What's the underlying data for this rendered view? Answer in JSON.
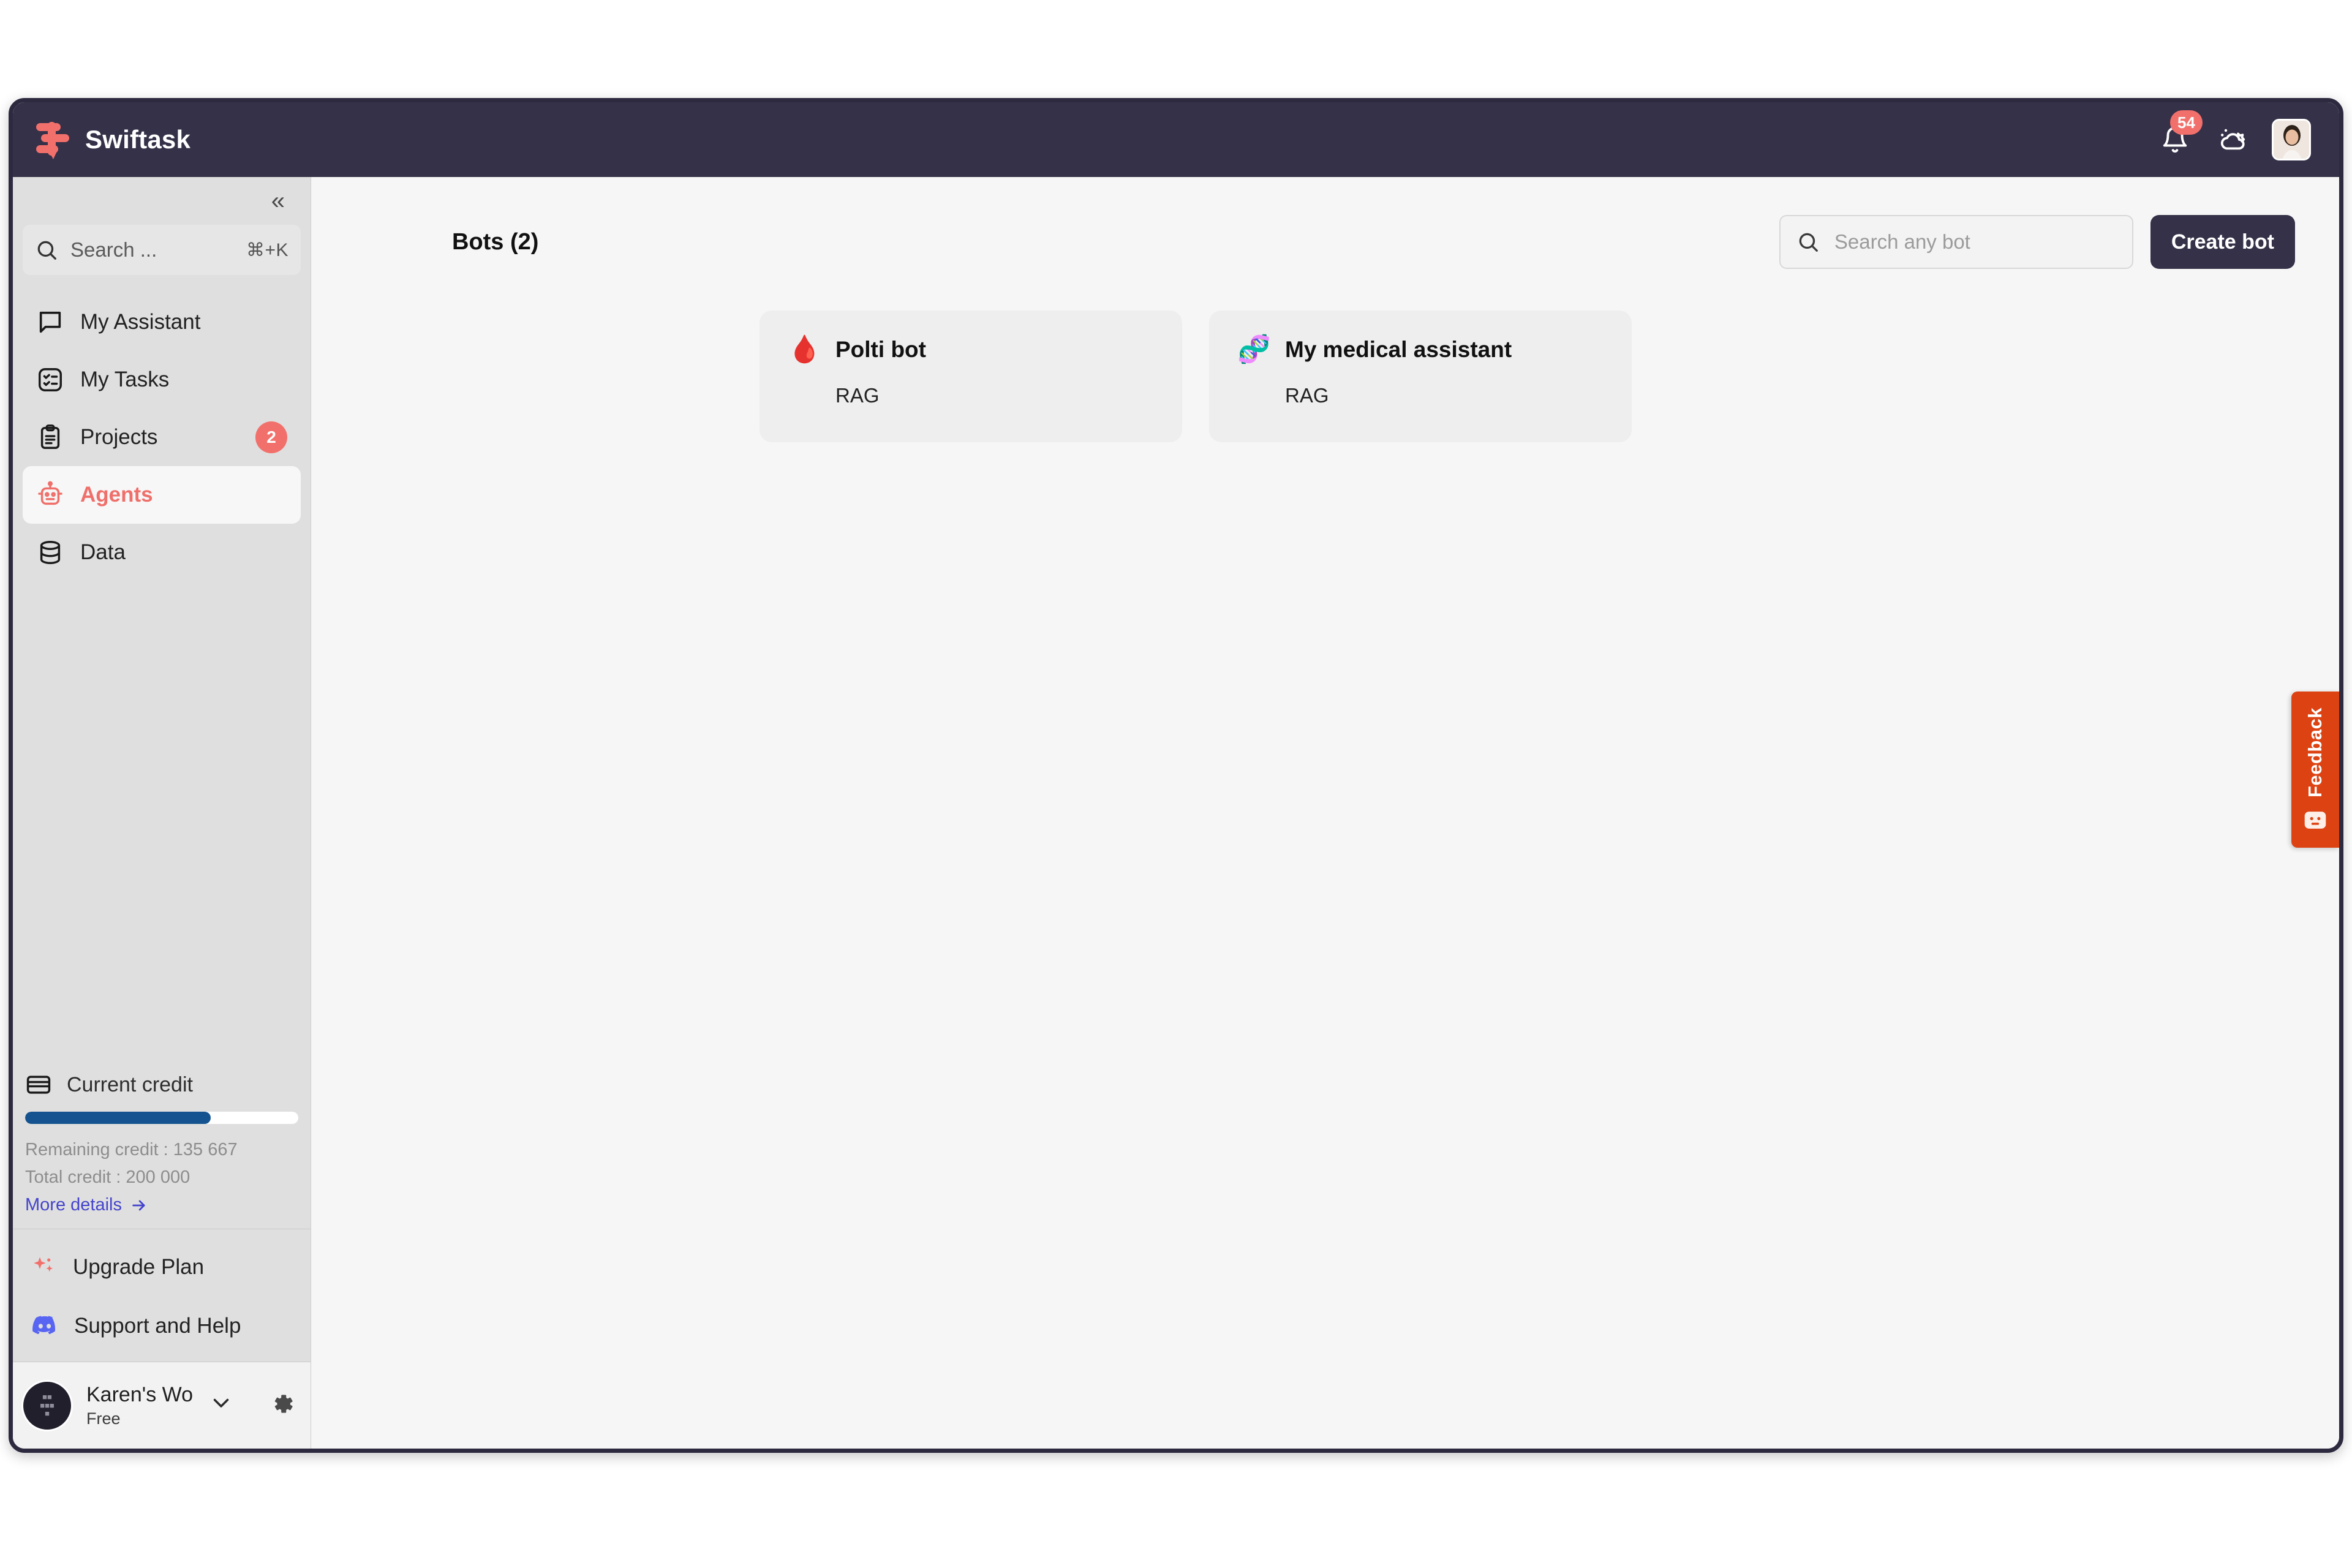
{
  "app": {
    "name": "Swiftask",
    "logo_icon": "swiftask-logo-icon"
  },
  "topbar": {
    "notification_icon": "bell-icon",
    "notification_count": "54",
    "weather_icon": "cloud-icon",
    "avatar_icon": "user-avatar"
  },
  "sidebar": {
    "collapse_icon": "chevron-double-left-icon",
    "search": {
      "label": "Search ...",
      "shortcut": "⌘+K",
      "icon": "search-icon"
    },
    "items": [
      {
        "label": "My Assistant",
        "icon": "chat-bubble-icon",
        "badge": "",
        "active": false
      },
      {
        "label": "My Tasks",
        "icon": "task-list-icon",
        "badge": "",
        "active": false
      },
      {
        "label": "Projects",
        "icon": "clipboard-icon",
        "badge": "2",
        "active": false
      },
      {
        "label": "Agents",
        "icon": "robot-icon",
        "badge": "",
        "active": true
      },
      {
        "label": "Data",
        "icon": "database-icon",
        "badge": "",
        "active": false
      }
    ],
    "credit": {
      "title": "Current credit",
      "icon": "credit-card-icon",
      "remaining_label": "Remaining credit : 135 667",
      "total_label": "Total credit : 200 000",
      "more_details": "More details",
      "more_details_icon": "arrow-right-icon",
      "percent": 68
    },
    "lower_links": [
      {
        "label": "Upgrade Plan",
        "icon": "sparkles-icon"
      },
      {
        "label": "Support and Help",
        "icon": "discord-icon"
      }
    ],
    "workspace": {
      "name": "Karen's Wo",
      "plan": "Free",
      "chevron_icon": "chevron-down-icon",
      "settings_icon": "gear-icon",
      "avatar_icon": "workspace-avatar"
    }
  },
  "main": {
    "title": "Bots (2)",
    "search": {
      "placeholder": "Search any bot",
      "value": "",
      "icon": "search-icon"
    },
    "create_button": "Create bot",
    "bots": [
      {
        "name": "Polti bot",
        "type": "RAG",
        "emoji": "🩸"
      },
      {
        "name": "My medical assistant",
        "type": "RAG",
        "emoji": "🧬"
      }
    ]
  },
  "feedback": {
    "label": "Feedback",
    "icon": "robot-face-icon",
    "color": "#dd4312"
  },
  "colors": {
    "topbar": "#353148",
    "sidebar": "#dfdfdf",
    "accent": "#ef6f6a",
    "badge": "#f2706b",
    "progress": "#14538f",
    "link": "#4444cc"
  }
}
